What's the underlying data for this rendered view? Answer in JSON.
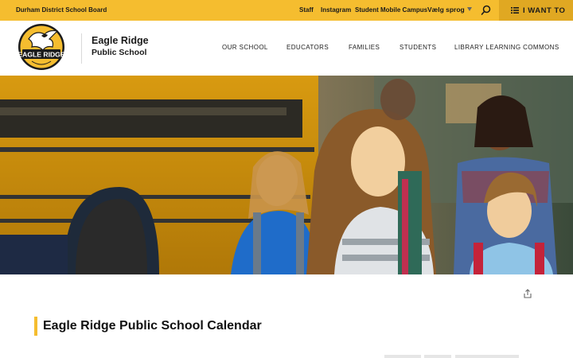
{
  "topbar": {
    "board_name": "Durham District School Board",
    "links": [
      "Staff",
      "Instagram",
      "Student Mobile Campus"
    ],
    "language_label": "Vælg sprog",
    "i_want_to_label": "I WANT TO"
  },
  "header": {
    "logo_text": "EAGLE RIDGE",
    "school_name": "Eagle Ridge",
    "school_sub": "Public School",
    "nav": [
      "OUR SCHOOL",
      "EDUCATORS",
      "FAMILIES",
      "STUDENTS",
      "LIBRARY LEARNING COMMONS"
    ]
  },
  "main": {
    "title": "Eagle Ridge Public School Calendar"
  },
  "colors": {
    "accent": "#f5bd2f",
    "accent_dark": "#e0a822",
    "text": "#1b1b1b"
  },
  "icons": [
    "search-icon",
    "menu-icon",
    "share-icon",
    "chevron-down-icon"
  ]
}
